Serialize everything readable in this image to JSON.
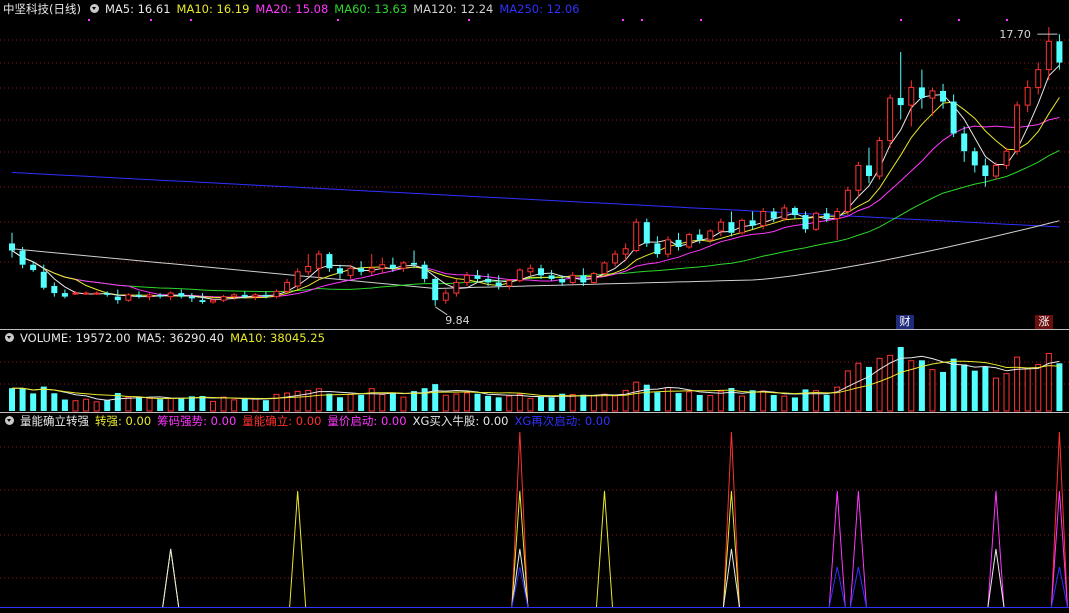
{
  "price_panel": {
    "title": "中坚科技(日线)",
    "ma5": "MA5: 16.61",
    "ma10": "MA10: 16.19",
    "ma20": "MA20: 15.08",
    "ma60": "MA60: 13.63",
    "ma120": "MA120: 12.24",
    "ma250": "MA250: 12.06",
    "event_badge_finance": "财",
    "event_badge_rise": "涨"
  },
  "volume_panel": {
    "volume": "VOLUME: 19572.00",
    "ma5": "MA5: 36290.40",
    "ma10": "MA10: 38045.25"
  },
  "indicator_panel": {
    "name": "量能确立转强",
    "zhuanqiang": "转强: 0.00",
    "choumaqiangshi": "筹码强势: 0.00",
    "liangnengqueli": "量能确立: 0.00",
    "liangjiaqidong": "量价启动: 0.00",
    "xg_buy": "XG买入牛股: 0.00",
    "xg_second": "XG再次启动: 0.00"
  },
  "colors": {
    "up": "#ff3232",
    "down": "#54ffff",
    "ma5": "#e8e8e8",
    "ma10": "#e8e82c",
    "ma20": "#ff37ff",
    "ma60": "#2cd82c",
    "ma120": "#d0d0d0",
    "ma250": "#3030ff",
    "grid": "#8a1a1a",
    "separator": "#c0c0c0"
  },
  "chart_data": [
    {
      "type": "candlestick",
      "panel": "price",
      "annotations": [
        {
          "label": "17.70",
          "bar": 99
        },
        {
          "label": "9.84",
          "bar": 40
        }
      ]
    },
    {
      "type": "bar",
      "panel": "volume"
    },
    {
      "type": "spike",
      "panel": "indicator",
      "series": [
        {
          "name": "转强",
          "color": "#e8e82c",
          "bars": [
            15,
            27,
            48,
            56,
            68
          ]
        },
        {
          "name": "筹码强势",
          "color": "#ff37ff",
          "bars": [
            78,
            80,
            93,
            99
          ]
        },
        {
          "name": "量能确立",
          "color": "#ff3030",
          "bars": [
            48,
            68,
            99
          ]
        },
        {
          "name": "XG买入牛股",
          "color": "#e8e8e8",
          "bars": [
            15,
            48,
            68,
            93
          ]
        },
        {
          "name": "XG再次启动",
          "color": "#3030ff",
          "bars": [
            48,
            78,
            80,
            99
          ]
        }
      ]
    }
  ]
}
